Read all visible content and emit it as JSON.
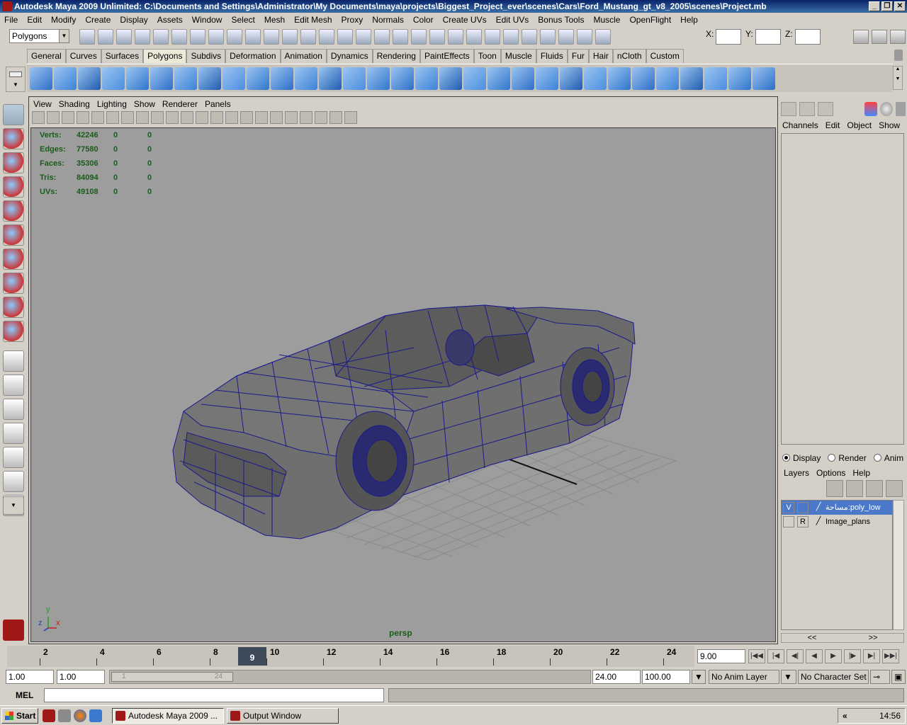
{
  "window": {
    "title": "Autodesk Maya 2009 Unlimited: C:\\Documents and Settings\\Administrator\\My Documents\\maya\\projects\\Biggest_Project_ever\\scenes\\Cars\\Ford_Mustang_gt_v8_2005\\scenes\\Project.mb",
    "minimize": "_",
    "restore": "❐",
    "close": "✕"
  },
  "menubar": [
    "File",
    "Edit",
    "Modify",
    "Create",
    "Display",
    "Assets",
    "Window",
    "Select",
    "Mesh",
    "Edit Mesh",
    "Proxy",
    "Normals",
    "Color",
    "Create UVs",
    "Edit UVs",
    "Bonus Tools",
    "Muscle",
    "OpenFlight",
    "Help"
  ],
  "statusline": {
    "mode": "Polygons",
    "x_label": "X:",
    "y_label": "Y:",
    "z_label": "Z:"
  },
  "shelf_tabs": [
    "General",
    "Curves",
    "Surfaces",
    "Polygons",
    "Subdivs",
    "Deformation",
    "Animation",
    "Dynamics",
    "Rendering",
    "PaintEffects",
    "Toon",
    "Muscle",
    "Fluids",
    "Fur",
    "Hair",
    "nCloth",
    "Custom"
  ],
  "shelf_active": "Polygons",
  "panel": {
    "menu": [
      "View",
      "Shading",
      "Lighting",
      "Show",
      "Renderer",
      "Panels"
    ],
    "camera": "persp",
    "hud": [
      {
        "label": "Verts:",
        "v1": "42246",
        "v2": "0",
        "v3": "0"
      },
      {
        "label": "Edges:",
        "v1": "77580",
        "v2": "0",
        "v3": "0"
      },
      {
        "label": "Faces:",
        "v1": "35306",
        "v2": "0",
        "v3": "0"
      },
      {
        "label": "Tris:",
        "v1": "84094",
        "v2": "0",
        "v3": "0"
      },
      {
        "label": "UVs:",
        "v1": "49108",
        "v2": "0",
        "v3": "0"
      }
    ],
    "axis": {
      "x": "x",
      "y": "y",
      "z": "z"
    }
  },
  "channel_box": {
    "menu": [
      "Channels",
      "Edit",
      "Object",
      "Show"
    ]
  },
  "layers": {
    "radios": [
      {
        "label": "Display",
        "on": true
      },
      {
        "label": "Render",
        "on": false
      },
      {
        "label": "Anim",
        "on": false
      }
    ],
    "menu": [
      "Layers",
      "Options",
      "Help"
    ],
    "items": [
      {
        "v": "V",
        "r": "",
        "name": "مساحة:poly_low",
        "selected": true
      },
      {
        "v": "",
        "r": "R",
        "name": "Image_plans",
        "selected": false
      }
    ],
    "nav_left": "<<",
    "nav_right": ">>"
  },
  "timeline": {
    "ticks": [
      "2",
      "4",
      "6",
      "8",
      "10",
      "12",
      "14",
      "16",
      "18",
      "20",
      "22",
      "24"
    ],
    "current_frame_marker": "9",
    "current_time": "9.00"
  },
  "range": {
    "start_time": "1.00",
    "playback_start": "1.00",
    "slider_start": "1",
    "slider_end": "24",
    "playback_end": "24.00",
    "end_time": "100.00",
    "anim_layer": "No Anim Layer",
    "character_set": "No Character Set"
  },
  "cmdline": {
    "label": "MEL"
  },
  "taskbar": {
    "start": "Start",
    "tasks": [
      {
        "label": "Autodesk Maya 2009 ...",
        "active": true
      },
      {
        "label": "Output Window",
        "active": false
      }
    ],
    "tray_chevron": "«",
    "clock": "14:56"
  },
  "colors": {
    "viewport": "#9d9d9d",
    "wireframe": "#1a1a8c",
    "hud_text": "#1a5c1a",
    "title_bar": "#0a246a"
  }
}
